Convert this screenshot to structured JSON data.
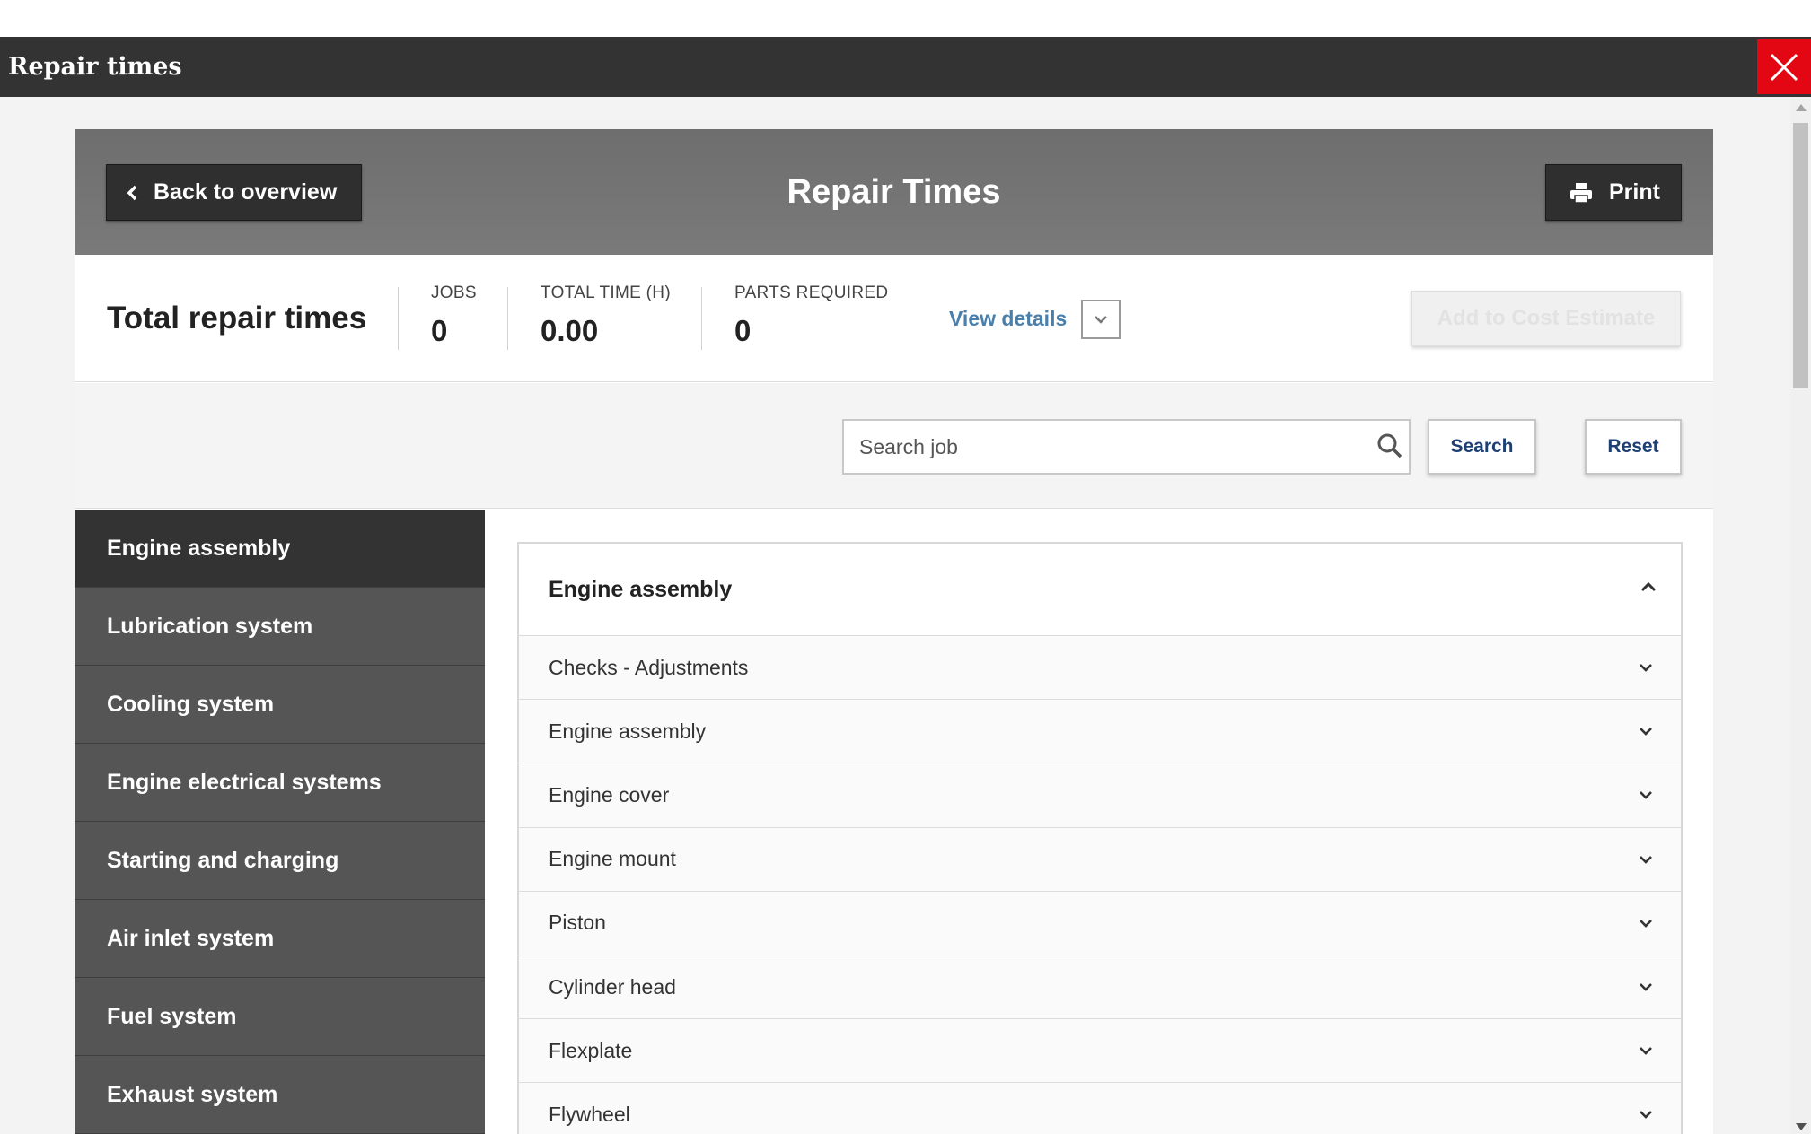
{
  "window": {
    "title": "Repair times"
  },
  "header": {
    "back_label": "Back to overview",
    "title": "Repair Times",
    "print_label": "Print"
  },
  "totals": {
    "title": "Total repair times",
    "metrics": [
      {
        "label": "JOBS",
        "value": "0"
      },
      {
        "label": "TOTAL TIME (H)",
        "value": "0.00"
      },
      {
        "label": "PARTS REQUIRED",
        "value": "0"
      }
    ],
    "view_details": "View details",
    "add_to_estimate": "Add to Cost Estimate"
  },
  "search": {
    "placeholder": "Search job",
    "search_label": "Search",
    "reset_label": "Reset"
  },
  "sidebar": {
    "items": [
      {
        "label": "Engine assembly",
        "active": true
      },
      {
        "label": "Lubrication system"
      },
      {
        "label": "Cooling system"
      },
      {
        "label": "Engine electrical systems"
      },
      {
        "label": "Starting and charging"
      },
      {
        "label": "Air inlet system"
      },
      {
        "label": "Fuel system"
      },
      {
        "label": "Exhaust system"
      }
    ]
  },
  "accordion": {
    "title": "Engine assembly",
    "items": [
      "Checks - Adjustments",
      "Engine assembly",
      "Engine cover",
      "Engine mount",
      "Piston",
      "Cylinder head",
      "Flexplate",
      "Flywheel"
    ]
  },
  "colors": {
    "close_button": "#e30613",
    "header_bg": "#6e6e6e",
    "sidebar_bg": "#555555",
    "sidebar_active": "#333333",
    "link": "#4a7fac",
    "button_text": "#1d3f73"
  },
  "icons": {
    "close": "close-icon",
    "back": "chevron-left-icon",
    "print": "printer-icon",
    "search": "search-icon",
    "expand": "chevron-down-icon",
    "collapse": "chevron-up-icon"
  }
}
